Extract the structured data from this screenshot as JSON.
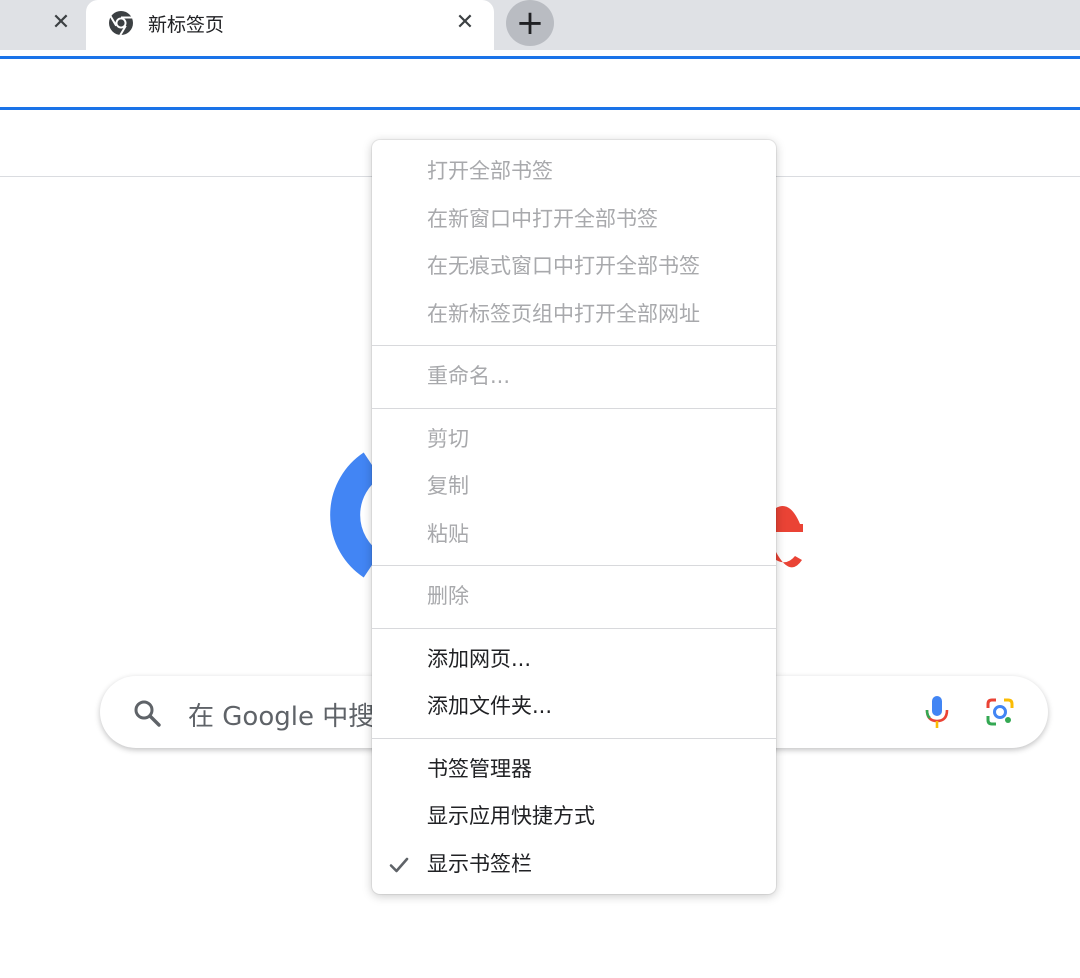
{
  "tabs": {
    "active_title": "新标签页",
    "new_tab_symbol": "+",
    "close_symbol": "✕"
  },
  "search": {
    "placeholder": "在 Google 中搜"
  },
  "context_menu": {
    "groups": [
      {
        "items": [
          {
            "label": "打开全部书签",
            "enabled": false
          },
          {
            "label": "在新窗口中打开全部书签",
            "enabled": false
          },
          {
            "label": "在无痕式窗口中打开全部书签",
            "enabled": false
          },
          {
            "label": "在新标签页组中打开全部网址",
            "enabled": false
          }
        ]
      },
      {
        "items": [
          {
            "label": "重命名...",
            "enabled": false
          }
        ]
      },
      {
        "items": [
          {
            "label": "剪切",
            "enabled": false
          },
          {
            "label": "复制",
            "enabled": false
          },
          {
            "label": "粘贴",
            "enabled": false
          }
        ]
      },
      {
        "items": [
          {
            "label": "删除",
            "enabled": false
          }
        ]
      },
      {
        "items": [
          {
            "label": "添加网页...",
            "enabled": true
          },
          {
            "label": "添加文件夹...",
            "enabled": true
          }
        ]
      },
      {
        "items": [
          {
            "label": "书签管理器",
            "enabled": true
          },
          {
            "label": "显示应用快捷方式",
            "enabled": true
          },
          {
            "label": "显示书签栏",
            "enabled": true,
            "checked": true
          }
        ]
      }
    ]
  },
  "colors": {
    "accent_blue": "#1a73e8",
    "tabstrip_bg": "#dfe1e5",
    "google_blue": "#4285f4",
    "google_red": "#ea4335",
    "google_yellow": "#fbbc04",
    "google_green": "#34a853",
    "disabled_text": "#a8a9ac"
  },
  "icons": {
    "browser_logo": "chrome-icon",
    "search": "search-icon",
    "voice": "mic-icon",
    "image_search": "lens-icon",
    "checked": "check-icon"
  }
}
